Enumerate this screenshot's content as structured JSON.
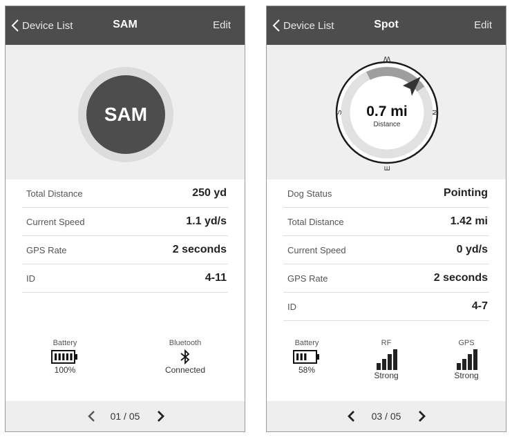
{
  "left": {
    "nav": {
      "back_label": "Device List",
      "title": "SAM",
      "edit_label": "Edit"
    },
    "avatar_text": "SAM",
    "rows": [
      {
        "label": "Total Distance",
        "value": "250 yd"
      },
      {
        "label": "Current Speed",
        "value": "1.1 yd/s"
      },
      {
        "label": "GPS Rate",
        "value": "2 seconds"
      },
      {
        "label": "ID",
        "value": "4-11"
      }
    ],
    "status": {
      "battery": {
        "title": "Battery",
        "value": "100%",
        "level": 1.0
      },
      "bluetooth": {
        "title": "Bluetooth",
        "value": "Connected"
      }
    },
    "pager": {
      "text": "01 / 05"
    }
  },
  "right": {
    "nav": {
      "back_label": "Device List",
      "title": "Spot",
      "edit_label": "Edit"
    },
    "compass": {
      "distance": "0.7 mi",
      "distance_label": "Distance",
      "directions": {
        "north": "N",
        "south": "S",
        "east": "E",
        "west": "W"
      }
    },
    "rows": [
      {
        "label": "Dog Status",
        "value": "Pointing"
      },
      {
        "label": "Total Distance",
        "value": "1.42 mi"
      },
      {
        "label": "Current Speed",
        "value": "0 yd/s"
      },
      {
        "label": "GPS Rate",
        "value": "2 seconds"
      },
      {
        "label": "ID",
        "value": "4-7"
      }
    ],
    "status": {
      "battery": {
        "title": "Battery",
        "value": "58%",
        "level": 0.5
      },
      "rf": {
        "title": "RF",
        "value": "Strong"
      },
      "gps": {
        "title": "GPS",
        "value": "Strong"
      }
    },
    "pager": {
      "text": "03 / 05"
    }
  },
  "colors": {
    "navbar": "#4d4d4d",
    "hero_bg": "#efefef",
    "pager_bg": "#eeeeee",
    "avatar": "#4d4d4d"
  }
}
